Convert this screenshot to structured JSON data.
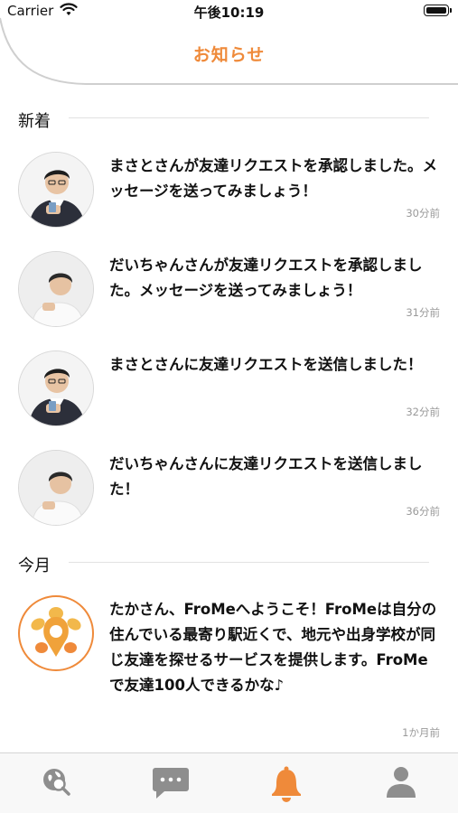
{
  "status_bar": {
    "carrier": "Carrier",
    "time": "午後10:19"
  },
  "header": {
    "title": "お知らせ"
  },
  "sections": {
    "new": {
      "label": "新着",
      "items": [
        {
          "text": "まさとさんが友達リクエストを承認しました。メッセージを送ってみましょう！",
          "time": "30分前"
        },
        {
          "text": "だいちゃんさんが友達リクエストを承認しました。メッセージを送ってみましょう！",
          "time": "31分前"
        },
        {
          "text": "まさとさんに友達リクエストを送信しました！",
          "time": "32分前"
        },
        {
          "text": "だいちゃんさんに友達リクエストを送信しました！",
          "time": "36分前"
        }
      ]
    },
    "month": {
      "label": "今月",
      "items": [
        {
          "text": "たかさん、FroMeへようこそ！FroMeは自分の住んでいる最寄り駅近くで、地元や出身学校が同じ友達を探せるサービスを提供します。FroMeで友達100人できるかな♪",
          "time": "1か月前"
        }
      ]
    }
  },
  "tab_bar": {
    "tabs": [
      {
        "icon": "search-location-icon",
        "active": false
      },
      {
        "icon": "chat-icon",
        "active": false
      },
      {
        "icon": "bell-icon",
        "active": true
      },
      {
        "icon": "person-icon",
        "active": false
      }
    ]
  },
  "colors": {
    "accent": "#ef8a3a",
    "inactive_icon": "#8e8e8e",
    "time_text": "#9a9a9a"
  }
}
